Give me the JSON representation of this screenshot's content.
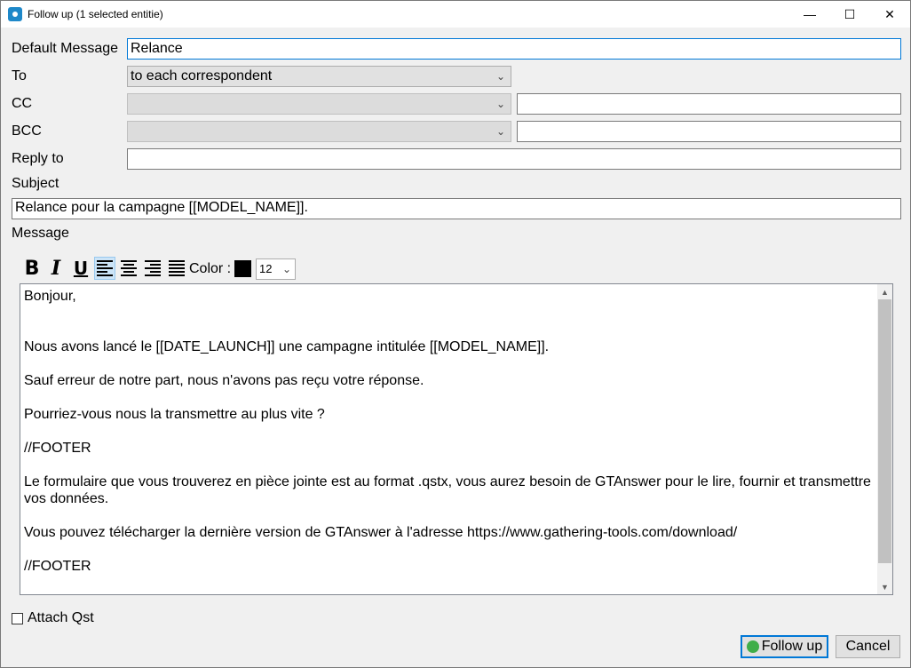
{
  "window": {
    "title": "Follow up (1 selected entitie)",
    "minimize_glyph": "—",
    "maximize_glyph": "☐",
    "close_glyph": "✕"
  },
  "form": {
    "default_message": {
      "label": "Default Message",
      "value": "Relance"
    },
    "to": {
      "label": "To",
      "selected": "to each correspondent"
    },
    "cc": {
      "label": "CC",
      "selected": "",
      "value": ""
    },
    "bcc": {
      "label": "BCC",
      "selected": "",
      "value": ""
    },
    "reply_to": {
      "label": "Reply to",
      "value": ""
    },
    "subject": {
      "label": "Subject",
      "value": "Relance pour la campagne [[MODEL_NAME]]."
    },
    "message_label": "Message"
  },
  "toolbar": {
    "bold": "B",
    "italic": "I",
    "underline": "U",
    "color_label": "Color :",
    "color_value": "#000000",
    "font_size": "12"
  },
  "message_body": "Bonjour,\n\n\nNous avons lancé le [[DATE_LAUNCH]] une campagne intitulée [[MODEL_NAME]].\n\nSauf erreur de notre part, nous n'avons pas reçu votre réponse.\n\nPourriez-vous nous la transmettre au plus vite ?\n\n//FOOTER\n\nLe formulaire que vous trouverez en pièce jointe est au format .qstx, vous aurez besoin de GTAnswer pour le lire, fournir et transmettre vos données.\n\nVous pouvez télécharger la dernière version de GTAnswer à l'adresse https://www.gathering-tools.com/download/\n\n//FOOTER",
  "attach": {
    "label": "Attach Qst",
    "checked": false
  },
  "buttons": {
    "follow_up": "Follow up",
    "cancel": "Cancel"
  },
  "colors": {
    "accent": "#0078d7",
    "follow_up_icon": "#3fae49"
  }
}
